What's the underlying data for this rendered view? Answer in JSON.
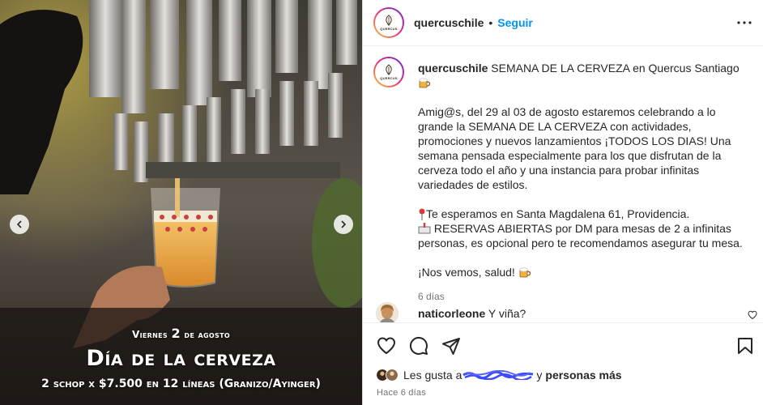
{
  "post": {
    "username": "quercuschile",
    "follow_label": "Seguir",
    "separator": "•",
    "brand_logo_text": "QUERCUS"
  },
  "media": {
    "overlay_date_prefix": "Viernes",
    "overlay_date_num": "2",
    "overlay_date_suffix": "de agosto",
    "overlay_title": "Día de la cerveza",
    "overlay_subtitle": "2 schop x $7.500 en 12 líneas (Granizo/Ayinger)",
    "has_prev": true,
    "has_next": true
  },
  "caption": {
    "username": "quercuschile",
    "title": "SEMANA DE LA CERVEZA en Quercus Santiago",
    "paragraph_1": "Amig@s, del 29 al 03 de agosto estaremos celebrando a lo grande la SEMANA DE LA CERVEZA con actividades, promociones y nuevos lanzamientos ¡TODOS LOS DIAS! Una semana pensada especialmente para los que disfrutan de la cerveza todo el año y una instancia para probar infinitas variedades de estilos.",
    "line_location": "Te esperamos en Santa Magdalena 61, Providencia.",
    "line_reservations": "RESERVAS ABIERTAS por DM para mesas de 2 a infinitas personas, es opcional pero te recomendamos asegurar tu mesa.",
    "closing": "¡Nos vemos, salud!",
    "time": "6 días"
  },
  "comments": [
    {
      "username": "naticorleone",
      "text": "Y viña?"
    }
  ],
  "likes": {
    "prefix": "Les gusta a",
    "suffix_and": "y",
    "suffix_rest": "personas más"
  },
  "footer": {
    "time_ago": "Hace 6 días"
  },
  "colors": {
    "accent": "#0095f6",
    "text": "#262626",
    "muted": "#737373",
    "border": "#dbdbdb"
  }
}
